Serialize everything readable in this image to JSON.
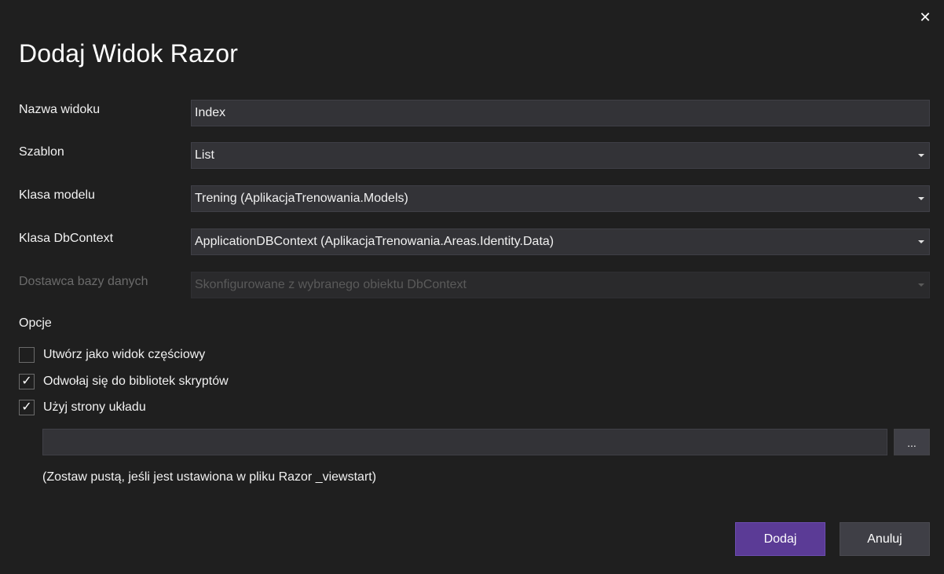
{
  "dialog": {
    "title": "Dodaj Widok Razor",
    "close_symbol": "✕"
  },
  "fields": {
    "view_name": {
      "label": "Nazwa widoku",
      "value": "Index"
    },
    "template": {
      "label": "Szablon",
      "value": "List"
    },
    "model_class": {
      "label": "Klasa modelu",
      "value": "Trening (AplikacjaTrenowania.Models)"
    },
    "dbcontext_class": {
      "label": "Klasa DbContext",
      "value": "ApplicationDBContext (AplikacjaTrenowania.Areas.Identity.Data)"
    },
    "database_provider": {
      "label": "Dostawca bazy danych",
      "value": "Skonfigurowane z wybranego obiektu DbContext",
      "disabled": true
    }
  },
  "options": {
    "label": "Opcje",
    "items": [
      {
        "label": "Utwórz jako widok częściowy",
        "checked": false
      },
      {
        "label": "Odwołaj się do bibliotek skryptów",
        "checked": true
      },
      {
        "label": "Użyj strony układu",
        "checked": true
      }
    ],
    "layout_path_value": "",
    "browse_label": "...",
    "hint": "(Zostaw pustą, jeśli jest ustawiona w pliku Razor _viewstart)"
  },
  "buttons": {
    "add": "Dodaj",
    "cancel": "Anuluj"
  },
  "colors": {
    "background": "#1f1f1f",
    "input": "#333337",
    "primary_button": "#5b3b96",
    "secondary_button": "#3f3f46"
  },
  "icons": {
    "close": "close-icon",
    "dropdown": "chevron-down-icon",
    "check": "checkmark-icon"
  }
}
